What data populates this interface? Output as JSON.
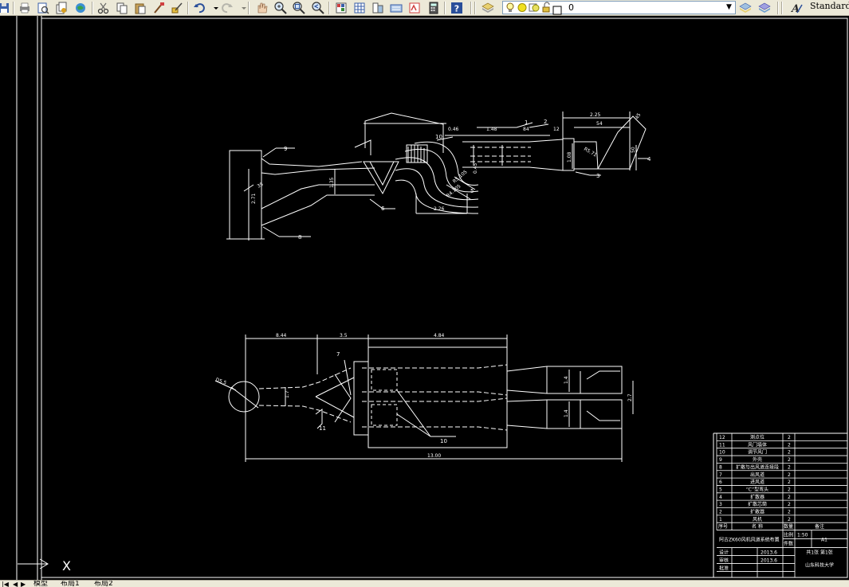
{
  "toolbar": {
    "buttons": [
      {
        "name": "save-icon"
      },
      {
        "name": "print-icon"
      },
      {
        "name": "plot-preview-icon"
      },
      {
        "name": "publish-icon"
      },
      {
        "name": "3d-dwf-icon"
      },
      {
        "name": "cut-icon"
      },
      {
        "name": "copy-icon"
      },
      {
        "name": "paste-icon"
      },
      {
        "name": "match-properties-icon"
      },
      {
        "name": "block-editor-icon"
      },
      {
        "name": "undo-icon"
      },
      {
        "name": "redo-icon"
      },
      {
        "name": "pan-icon"
      },
      {
        "name": "zoom-realtime-icon"
      },
      {
        "name": "zoom-window-icon"
      },
      {
        "name": "zoom-previous-icon"
      },
      {
        "name": "properties-icon"
      },
      {
        "name": "design-center-icon"
      },
      {
        "name": "tool-palettes-icon"
      },
      {
        "name": "sheet-set-icon"
      },
      {
        "name": "markup-icon"
      },
      {
        "name": "calculator-icon"
      },
      {
        "name": "help-icon"
      },
      {
        "name": "layer-properties-icon"
      }
    ],
    "layer": {
      "current": "0",
      "state_icons": [
        "bulb-on-icon",
        "sun-thaw-icon",
        "viewport-thaw-icon",
        "lock-open-icon",
        "color-swatch-icon"
      ]
    },
    "layer_state_buttons": [
      {
        "name": "make-current-layer-icon"
      },
      {
        "name": "layer-previous-icon"
      }
    ],
    "text_style": {
      "value": "Standard",
      "icon": "text-style-icon"
    }
  },
  "tabs": {
    "nav": [
      "|◀",
      "◀",
      "▶",
      "▶|"
    ],
    "items": [
      {
        "label": "模型"
      },
      {
        "label": "布局1"
      },
      {
        "label": "布局2"
      }
    ]
  },
  "drawing": {
    "colors": {
      "background": "#000000",
      "lines": "#ffffff"
    },
    "top_view_dims": {
      "d_225": "2.25",
      "d_54a": "54",
      "d_45": "45",
      "d_048": "0.46",
      "d_148": "1.48",
      "d_84": "84",
      "d_12": "12",
      "d_108": "1.08",
      "d_d5071": "R5.71",
      "d_50": "50",
      "d_135": "1.35",
      "d_271": "2.71",
      "d_35": "35",
      "d_R5105": "R5.105",
      "d_R4105": "R4.105",
      "d_226": "2.26",
      "d_045": "0.45"
    },
    "top_view_labels": {
      "l1": "1",
      "l2": "2",
      "l3": "3",
      "l4": "4",
      "l5": "5",
      "l6": "6",
      "l8": "8",
      "l9": "9",
      "l10": "10"
    },
    "plan_view_dims": {
      "d_844": "8.44",
      "d_35": "3.5",
      "d_484": "4.84",
      "d_1300": "13.00",
      "d_d55": "D5.5",
      "d_17": "1.7",
      "d_14a": "1.4",
      "d_14b": "1.4",
      "d_27": "2.7"
    },
    "plan_view_labels": {
      "l7": "7",
      "l10": "10",
      "l11": "11"
    },
    "ucs": {
      "x_label": "X"
    }
  },
  "title_block": {
    "parts": [
      {
        "no": "12",
        "name": "测点位",
        "qty": "2"
      },
      {
        "no": "11",
        "name": "风门墙体",
        "qty": "2"
      },
      {
        "no": "10",
        "name": "调节风门",
        "qty": "2"
      },
      {
        "no": "9",
        "name": "外壳",
        "qty": "2"
      },
      {
        "no": "8",
        "name": "扩散与出风道连接段",
        "qty": "2"
      },
      {
        "no": "7",
        "name": "出风道",
        "qty": "2"
      },
      {
        "no": "6",
        "name": "进风道",
        "qty": "2"
      },
      {
        "no": "5",
        "name": "“C”型弯头",
        "qty": "2"
      },
      {
        "no": "4",
        "name": "扩散器",
        "qty": "2"
      },
      {
        "no": "3",
        "name": "扩散芯筒",
        "qty": "2"
      },
      {
        "no": "2",
        "name": "扩散器",
        "qty": "2"
      },
      {
        "no": "1",
        "name": "风机",
        "qty": "2"
      }
    ],
    "header": {
      "no": "序号",
      "name": "名      称",
      "qty": "数量",
      "note": "备注"
    },
    "project": "阿古ZK60风机风道系统布置",
    "scale_label": "比例",
    "scale": "1:50",
    "sheet_label": "件数",
    "size": "A1",
    "sheets": "共1张 第1张",
    "design_label": "设计",
    "check_label": "审核",
    "approve_label": "批准",
    "date1": "2013.6",
    "date2": "2013.6",
    "school": "山东科技大学"
  }
}
